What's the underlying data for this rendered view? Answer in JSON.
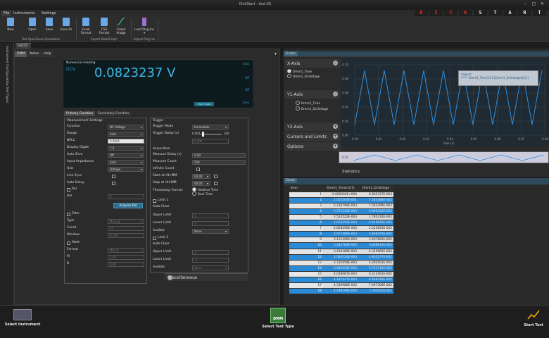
{
  "window": {
    "title": "KickStart - test.KS",
    "minimize": "–",
    "maximize": "□",
    "close": "✕"
  },
  "brand": [
    "K",
    "I",
    "C",
    "K",
    "S",
    "T",
    "A",
    "R",
    "T"
  ],
  "menu": [
    "File",
    "Instruments",
    "Settings"
  ],
  "ribbon": {
    "buttons": [
      {
        "label": "New",
        "icon": "new-file-icon",
        "color": "#6aa8e8"
      },
      {
        "label": "Open",
        "icon": "open-folder-icon",
        "color": "#6aa8e8"
      },
      {
        "label": "Save",
        "icon": "save-icon",
        "color": "#6aa8e8"
      },
      {
        "label": "Save As",
        "icon": "save-as-icon",
        "color": "#6aa8e8"
      },
      {
        "label": "Excel Format",
        "icon": "excel-icon",
        "color": "#6aa8e8"
      },
      {
        "label": "CSV Format",
        "icon": "csv-icon",
        "color": "#6aa8e8"
      },
      {
        "label": "Graph Image",
        "icon": "graph-image-icon",
        "color": "#3cc07a"
      },
      {
        "label": "Load Plug-Ins ▾",
        "icon": "plugin-icon",
        "color": "#a070d0"
      }
    ],
    "groups": [
      "Test Open/Save Operations",
      "Export Data/Graph",
      "Import Plug-Ins"
    ]
  },
  "doc_tab": "test35",
  "sidebar_label": "Instrument Configuration  Test Types",
  "left": {
    "tabs": [
      "DMM",
      "Notes",
      "Help"
    ],
    "readout": {
      "caption": "Numerical reading",
      "mode": "DCV",
      "value": "0.0823237 V",
      "auto_labels": [
        "Auto",
        "Off",
        "Off",
        "Zero"
      ],
      "mini": "Chart Data"
    },
    "function_tabs": [
      "Primary Function",
      "Secondary Function"
    ],
    "measurement": {
      "title": "Measurement Settings",
      "rows": [
        {
          "label": "Function",
          "value": "DC Voltage",
          "kind": "dd"
        },
        {
          "label": "Range",
          "value": "Auto",
          "kind": "dd"
        },
        {
          "label": "NPLC",
          "value": "0.0005",
          "kind": "light"
        },
        {
          "label": "Display Digits",
          "value": "7.5",
          "kind": "dd"
        },
        {
          "label": "Auto Zero",
          "value": "Off",
          "kind": "dd"
        },
        {
          "label": "Input Impedance",
          "value": "Auto",
          "kind": "dd"
        },
        {
          "label": "Unit",
          "value": "Voltage",
          "kind": "dd"
        }
      ],
      "checks": [
        "Line Sync",
        "Auto Delay"
      ]
    },
    "rel": {
      "title": "Rel",
      "label": "Rel",
      "value": "0",
      "button": "Acquire Rel"
    },
    "filter": {
      "title": "Filter",
      "rows": [
        {
          "label": "Type",
          "value": "Moving"
        },
        {
          "label": "Count",
          "value": "10"
        },
        {
          "label": "Window",
          "value": "0.100"
        }
      ]
    },
    "math": {
      "title": "Math",
      "rows": [
        {
          "label": "Format",
          "value": "MX+B"
        },
        {
          "label": "M",
          "value": "1.00"
        },
        {
          "label": "B",
          "value": "0.00"
        }
      ]
    },
    "trigger": {
      "title": "Trigger",
      "mode_label": "Trigger Mode",
      "mode_value": "Immediate",
      "delay_label": "Trigger Delay (s)",
      "delay_min": "0.001",
      "delay_max": "100",
      "delay_value": "0.000"
    },
    "acquisition": {
      "title": "Acquisition",
      "rows": [
        {
          "label": "Measure Delay (s)",
          "value": "0.00"
        },
        {
          "label": "Measure Count",
          "value": "500"
        },
        {
          "label": "Infinite Count",
          "value": ""
        },
        {
          "label": "Start at HH:MM",
          "value": "00:00"
        },
        {
          "label": "Stop at HH:MM",
          "value": "00:00"
        }
      ],
      "ts_label": "Timestamp Format",
      "ts_opts": [
        "Relative Time",
        "Real Time"
      ]
    },
    "limit1": {
      "title": "Limit 1",
      "rows": [
        {
          "label": "Auto Clear",
          "value": ""
        },
        {
          "label": "Upper Limit",
          "value": "1"
        },
        {
          "label": "Lower Limit",
          "value": "-1"
        },
        {
          "label": "Audible",
          "value": "None"
        }
      ]
    },
    "limit2": {
      "title": "Limit 2",
      "rows": [
        {
          "label": "Auto Clear",
          "value": ""
        },
        {
          "label": "Upper Limit",
          "value": "1"
        },
        {
          "label": "Lower Limit",
          "value": "-1"
        },
        {
          "label": "Audible",
          "value": "None"
        }
      ]
    },
    "misc": "Miscellaneous"
  },
  "graph": {
    "tab": "Graph",
    "x_axis": {
      "title": "X-Axis",
      "options": [
        "Dmm1_Time",
        "Dmm1_DcVoltage"
      ]
    },
    "y1_axis": {
      "title": "Y1-Axis",
      "options": [
        "Dmm1_Time",
        "Dmm1_DcVoltage"
      ]
    },
    "y2_axis": "Y2-Axis",
    "cursors": "Cursors and Limits",
    "options": "Options",
    "legend": {
      "title": "Legend",
      "entry": "Dmm1_Time(1)[1]:Dmm1_DcVoltage(1)[1]"
    },
    "y_ticks": [
      "0.10",
      "0.08",
      "0.06",
      "0.04",
      "0.02",
      "0.00"
    ],
    "x_ticks": [
      "0.00",
      "0.01",
      "0.02",
      "0.03",
      "0.04",
      "0.05",
      "0.06",
      "0.07",
      "0.08"
    ],
    "xlabel": "Time (s)",
    "overview_tick": "0.05",
    "statistics": "Statistics",
    "series_color": "#2f8fe0"
  },
  "sheet": {
    "tab": "Sheet",
    "headers": [
      "Item",
      "Dmm1_Time(1)[1]",
      "Dmm1_DcVoltage"
    ],
    "rows": [
      [
        "1",
        "0.000000E+000",
        "8.96531TE-003"
      ],
      [
        "2",
        "2.055500E-001",
        "7.283088E-002"
      ],
      [
        "3",
        "2.218790E-003",
        "1.032299E-002"
      ],
      [
        "4",
        "2.375240E-003",
        "5.965424E-002"
      ],
      [
        "5",
        "2.524522E-003",
        "1.780230E-002"
      ],
      [
        "6",
        "2.678350E-003",
        "5.419629E-002"
      ],
      [
        "7",
        "2.828290E-003",
        "2.525650E-002"
      ],
      [
        "8",
        "2.977480E-003",
        "3.868160E-002"
      ],
      [
        "9",
        "3.131290E-003",
        "3.407892E-002"
      ],
      [
        "10",
        "3.283780E-003",
        "3.868615E-002"
      ],
      [
        "11",
        "3.434189E-003",
        "4.319966E-002"
      ],
      [
        "12",
        "3.584524E-003",
        "4.805277E-002"
      ],
      [
        "13",
        "3.735659E-003",
        "5.282953E-002"
      ],
      [
        "14",
        "3.889229E-003",
        "5.752716E-002"
      ],
      [
        "15",
        "4.038087E-003",
        "6.213461E-002"
      ],
      [
        "16",
        "4.187427E-003",
        "6.668319E-002"
      ],
      [
        "17",
        "4.339986E-003",
        "7.097508E-002"
      ],
      [
        "18",
        "4.488196E-003",
        "7.504425E-002"
      ]
    ]
  },
  "bottom": {
    "select_instrument": "Select Instrument",
    "select_test_type": "Select Test Type",
    "test_type_badge": "DMM",
    "start_test": "Start Test"
  }
}
